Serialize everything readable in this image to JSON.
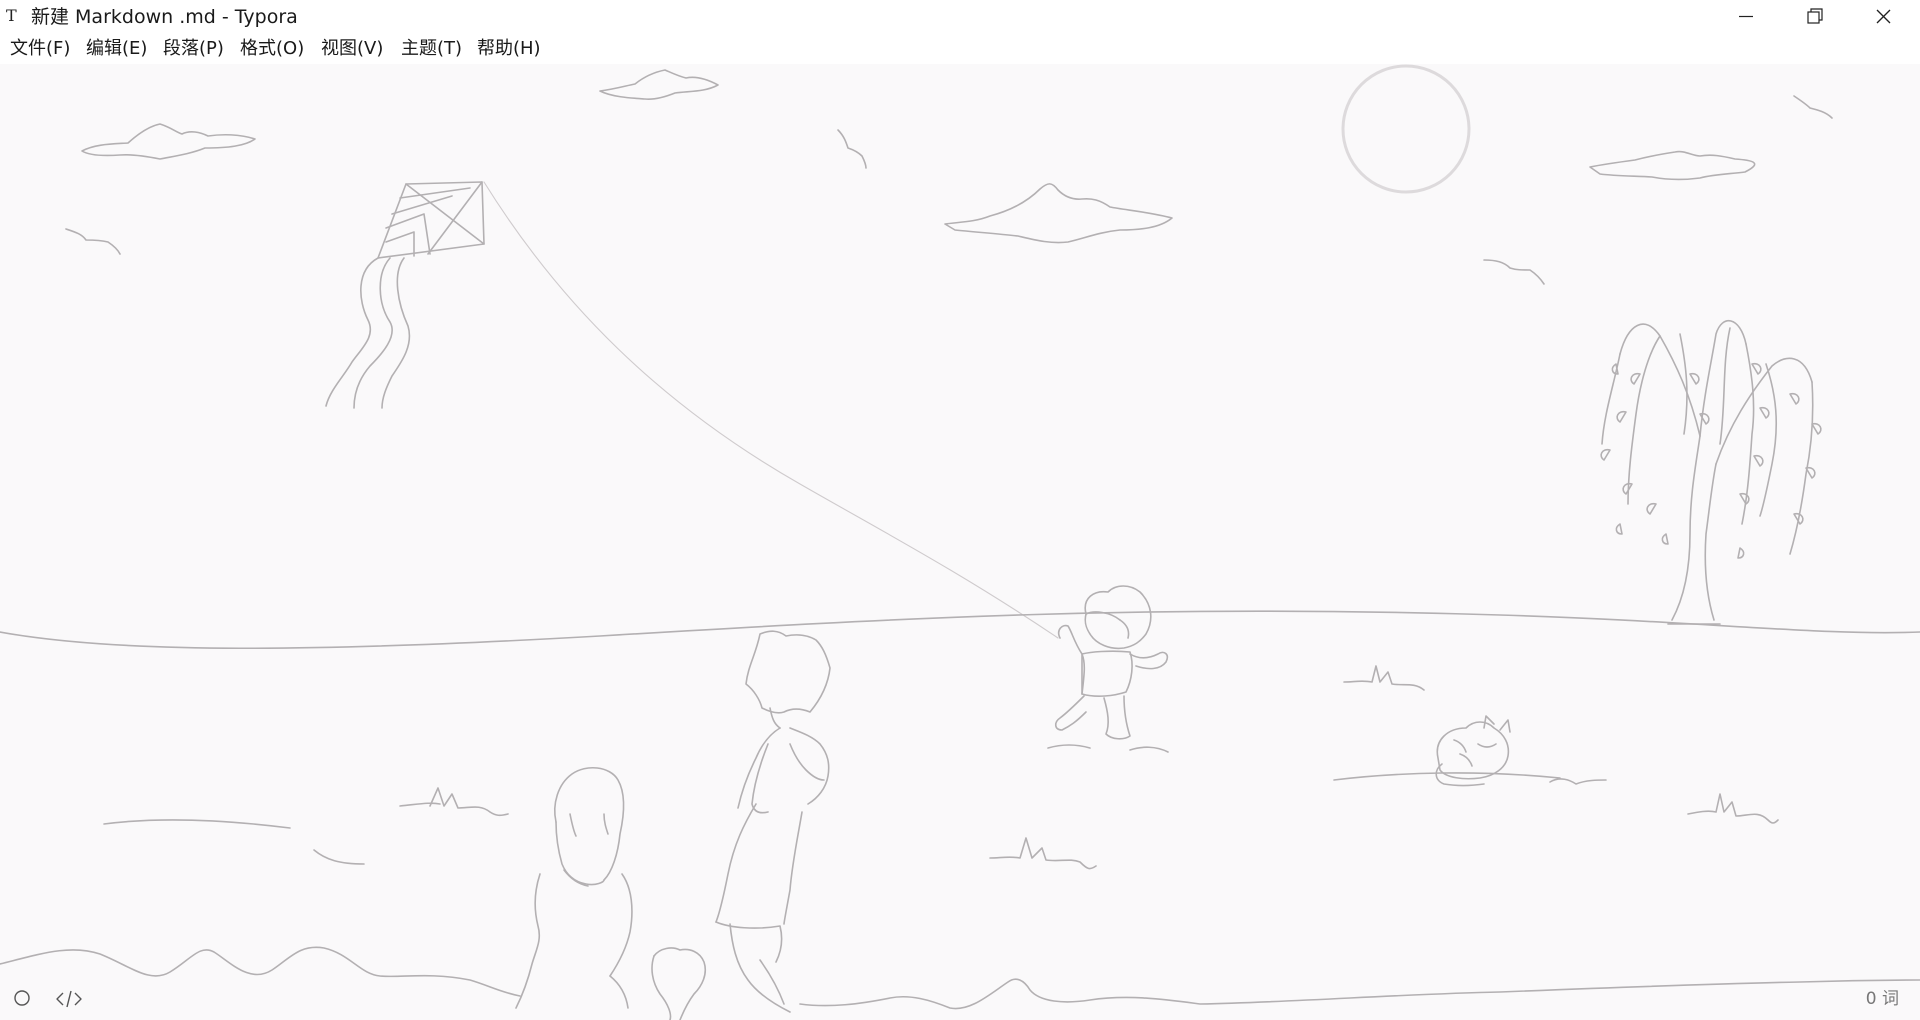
{
  "window": {
    "title": "新建 Markdown .md - Typora",
    "icon_glyph": "T"
  },
  "menubar": {
    "items": [
      {
        "label": "文件(F)"
      },
      {
        "label": "编辑(E)"
      },
      {
        "label": "段落(P)"
      },
      {
        "label": "格式(O)"
      },
      {
        "label": "视图(V)"
      },
      {
        "label": "主题(T)"
      },
      {
        "label": "帮助(H)"
      }
    ]
  },
  "window_controls": {
    "minimize_icon": "minimize-icon",
    "restore_icon": "restore-icon",
    "close_icon": "close-icon"
  },
  "footer": {
    "sidebar_icon": "circle-icon",
    "source_icon": "code-icon",
    "word_count": "0 词"
  },
  "theme": {
    "background": "#faf9fa",
    "sketch_stroke": "#b3b0b2"
  }
}
